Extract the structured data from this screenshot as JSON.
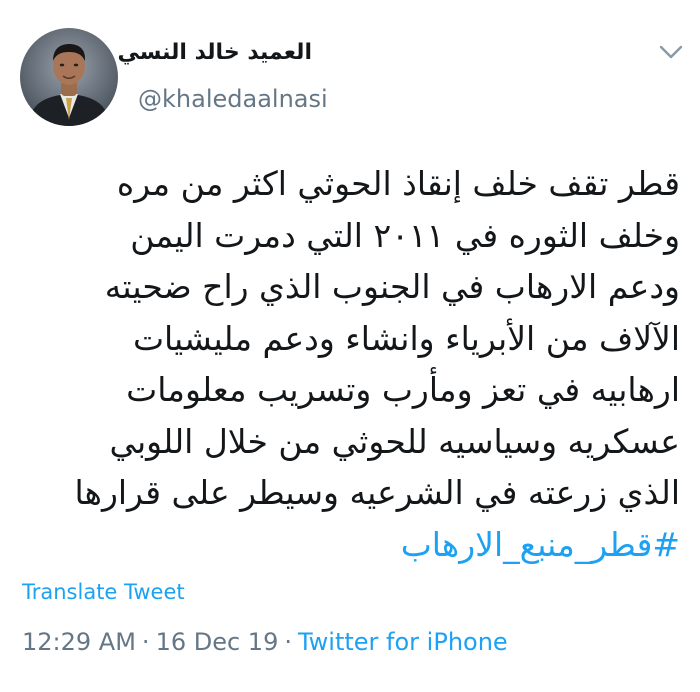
{
  "author": {
    "display_name": "العميد خالد النسي",
    "handle": "@khaledaalnasi"
  },
  "tweet": {
    "lines": [
      "قطر تقف خلف إنقاذ الحوثي اكثر من مره",
      "وخلف الثوره في ٢٠١١ التي دمرت اليمن",
      "ودعم الارهاب في الجنوب الذي راح ضحيته",
      "الآلاف من الأبرياء وانشاء ودعم مليشيات",
      "ارهابيه في تعز ومأرب وتسريب معلومات",
      "عسكريه وسياسيه للحوثي من خلال اللوبي",
      "الذي زرعته في الشرعيه وسيطر على قرارها"
    ],
    "hashtag": "#قطر_منبع_الارهاب"
  },
  "translate_label": "Translate Tweet",
  "meta": {
    "time": "12:29 AM",
    "separator": "·",
    "date": "16 Dec 19",
    "source": "Twitter for iPhone"
  },
  "colors": {
    "link": "#1da1f2",
    "secondary_text": "#657786",
    "primary_text": "#14171a"
  },
  "icons": {
    "menu": "chevron-down-icon",
    "avatar": "avatar"
  }
}
